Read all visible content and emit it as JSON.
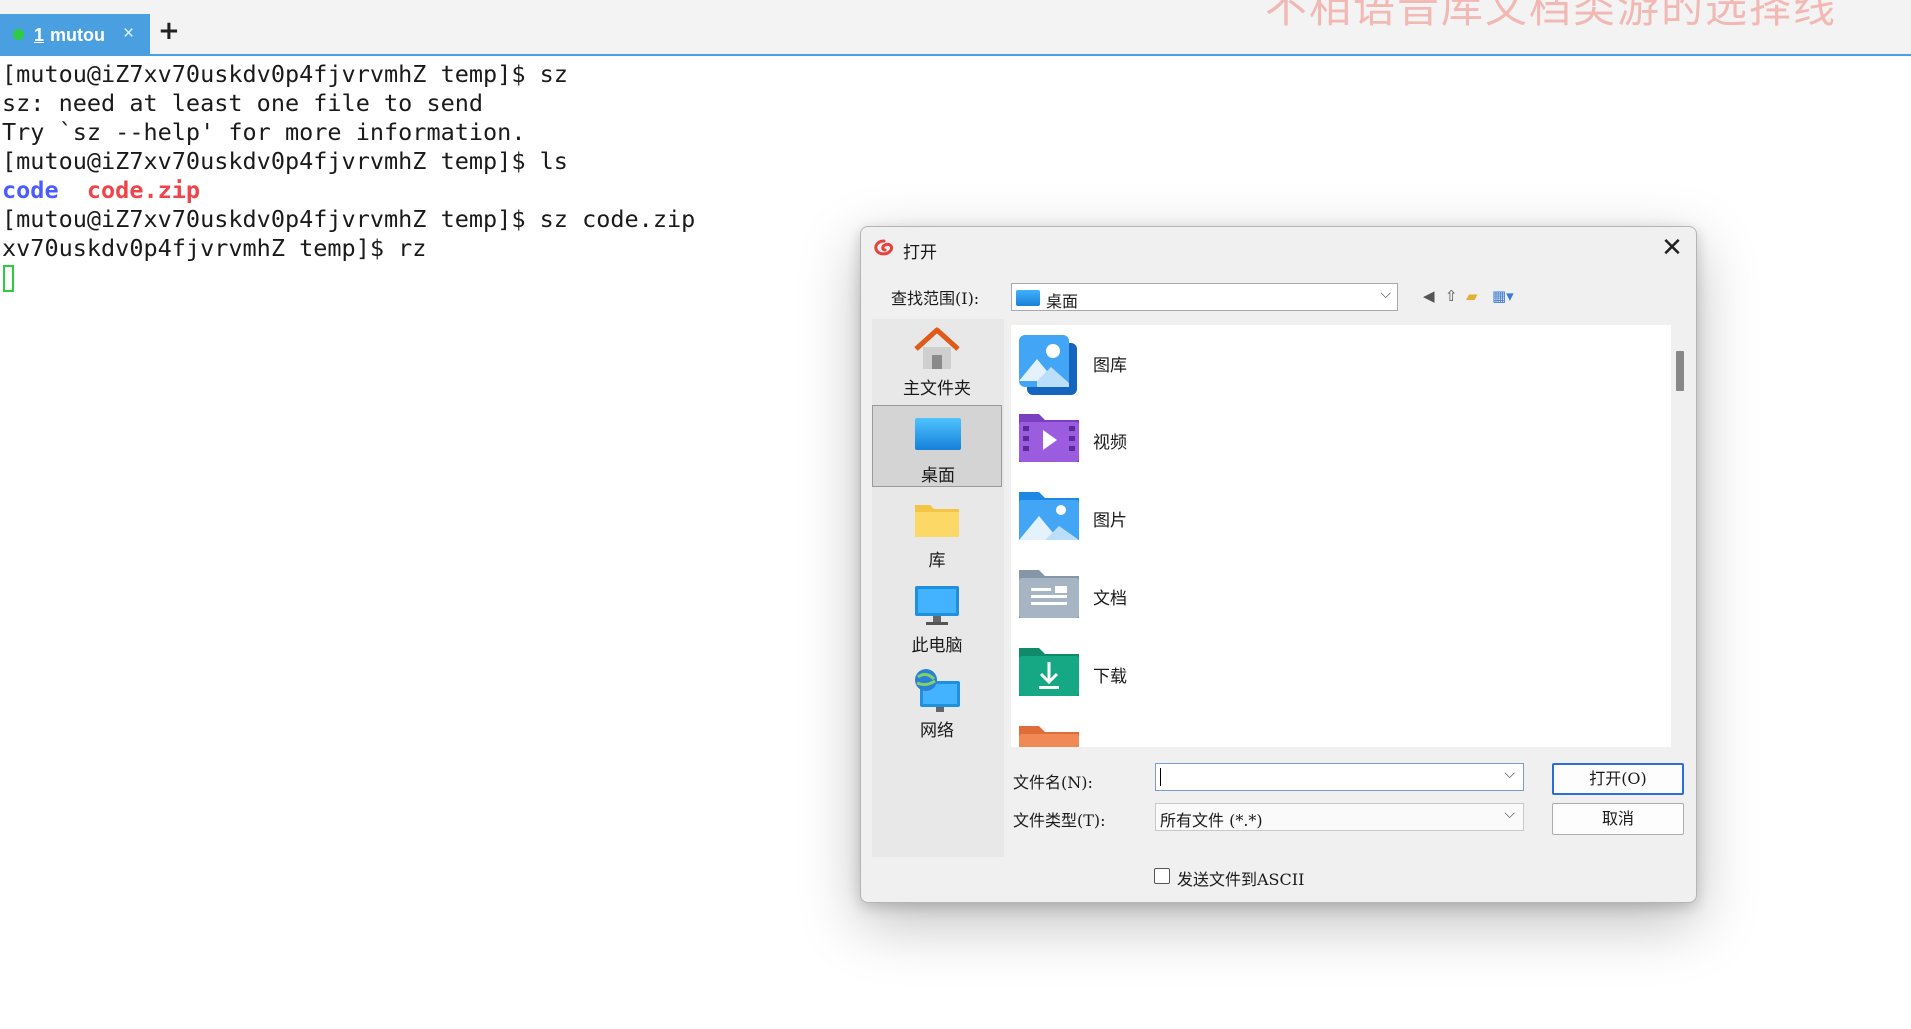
{
  "tabbar": {
    "tab_number": "1",
    "tab_name": "mutou",
    "close_glyph": "×",
    "new_tab_glyph": "+",
    "overlay_caption": "不相语音库文档类游的选择线",
    "accent_color": "#4a9fe0",
    "status_dot_color": "#2ecc40"
  },
  "terminal": {
    "lines": [
      "[mutou@iZ7xv70uskdv0p4fjvrvmhZ temp]$ sz",
      "sz: need at least one file to send",
      "Try `sz --help' for more information.",
      "[mutou@iZ7xv70uskdv0p4fjvrvmhZ temp]$ ls",
      "[mutou@iZ7xv70uskdv0p4fjvrvmhZ temp]$ sz code.zip",
      "xv70uskdv0p4fjvrvmhZ temp]$ rz"
    ],
    "ls_output": {
      "dir": "code",
      "archive": "code.zip",
      "dir_color": "#4b5cff",
      "archive_color": "#f0434a"
    }
  },
  "dialog": {
    "title": "打开",
    "close_glyph": "✕",
    "look_in_label": "查找范围(I):",
    "look_in_value": "桌面",
    "places": [
      {
        "label": "主文件夹",
        "icon": "home-icon"
      },
      {
        "label": "桌面",
        "icon": "desktop-icon",
        "selected": true
      },
      {
        "label": "库",
        "icon": "library-folder-icon"
      },
      {
        "label": "此电脑",
        "icon": "computer-icon"
      },
      {
        "label": "网络",
        "icon": "network-icon"
      }
    ],
    "files": [
      {
        "label": "图库",
        "icon": "gallery-icon"
      },
      {
        "label": "视频",
        "icon": "videos-folder-icon"
      },
      {
        "label": "图片",
        "icon": "pictures-folder-icon"
      },
      {
        "label": "文档",
        "icon": "documents-folder-icon"
      },
      {
        "label": "下载",
        "icon": "downloads-folder-icon"
      }
    ],
    "filename_label": "文件名(N):",
    "filename_value": "",
    "filetype_label": "文件类型(T):",
    "filetype_value": "所有文件 (*.*)",
    "open_button": "打开(O)",
    "cancel_button": "取消",
    "ascii_checkbox_label": "发送文件到ASCII",
    "ascii_checked": false
  }
}
